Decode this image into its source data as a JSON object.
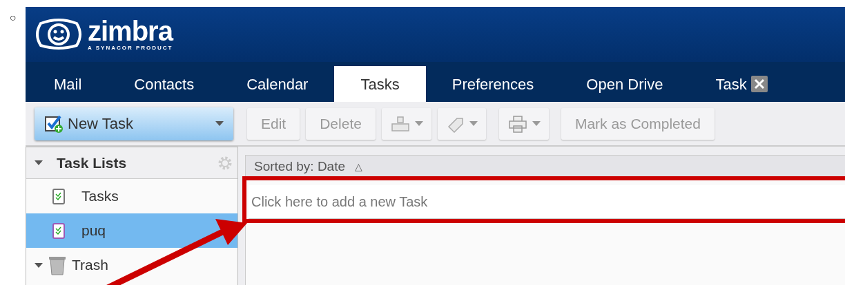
{
  "bullet": "○",
  "app": {
    "logo": {
      "wordmark": "zimbra",
      "tagline": "A SYNACOR PRODUCT"
    },
    "tabs": [
      {
        "label": "Mail",
        "selected": false,
        "closable": false
      },
      {
        "label": "Contacts",
        "selected": false,
        "closable": false
      },
      {
        "label": "Calendar",
        "selected": false,
        "closable": false
      },
      {
        "label": "Tasks",
        "selected": true,
        "closable": false
      },
      {
        "label": "Preferences",
        "selected": false,
        "closable": false
      },
      {
        "label": "Open Drive",
        "selected": false,
        "closable": false
      },
      {
        "label": "Task",
        "selected": false,
        "closable": true
      }
    ],
    "toolbar": {
      "new_button": "New Task",
      "buttons": [
        {
          "kind": "text",
          "label": "Edit"
        },
        {
          "kind": "text",
          "label": "Delete"
        },
        {
          "kind": "move"
        },
        {
          "kind": "tag"
        },
        {
          "kind": "print"
        },
        {
          "kind": "text",
          "label": "Mark as Completed"
        }
      ]
    },
    "sidebar": {
      "header": "Task Lists",
      "items": [
        {
          "kind": "list",
          "label": "Tasks",
          "selected": false,
          "color": "#777777"
        },
        {
          "kind": "list",
          "label": "puq",
          "selected": true,
          "color": "#9b59b6"
        },
        {
          "kind": "trash",
          "label": "Trash",
          "selected": false
        }
      ]
    },
    "main": {
      "sort_label": "Sorted by: Date",
      "sort_indicator": "△",
      "new_task_placeholder": "Click here to add a new Task"
    }
  }
}
